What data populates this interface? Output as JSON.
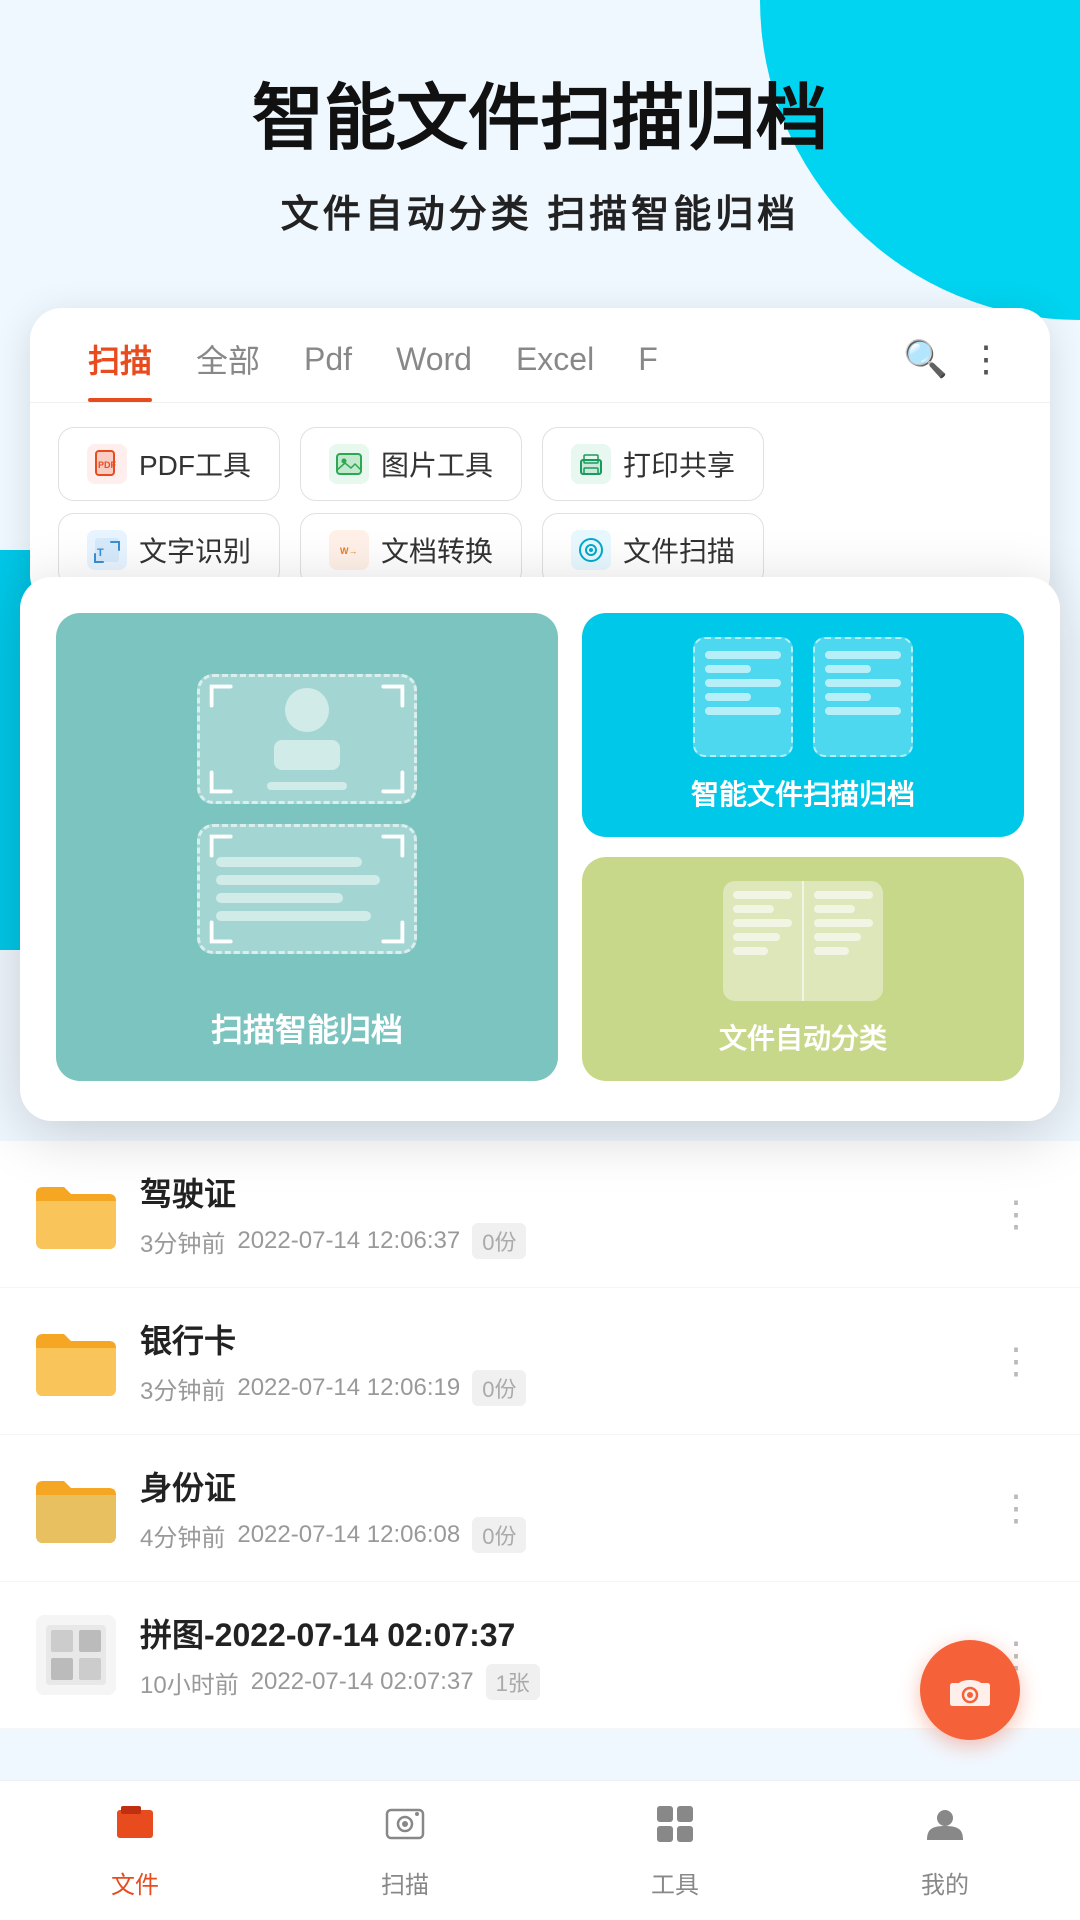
{
  "hero": {
    "title": "智能文件扫描归档",
    "subtitle": "文件自动分类   扫描智能归档"
  },
  "tabs": {
    "items": [
      {
        "label": "扫描",
        "active": true
      },
      {
        "label": "全部",
        "active": false
      },
      {
        "label": "Pdf",
        "active": false
      },
      {
        "label": "Word",
        "active": false
      },
      {
        "label": "Excel",
        "active": false
      },
      {
        "label": "F",
        "active": false
      }
    ]
  },
  "tools": {
    "row1": [
      {
        "label": "PDF工具",
        "icon": "pdf"
      },
      {
        "label": "图片工具",
        "icon": "img"
      },
      {
        "label": "打印共享",
        "icon": "print"
      }
    ],
    "row2": [
      {
        "label": "文字识别",
        "icon": "ocr"
      },
      {
        "label": "文档转换",
        "icon": "convert"
      },
      {
        "label": "文件扫描",
        "icon": "scan"
      }
    ]
  },
  "popup": {
    "left_label": "扫描智能归档",
    "right_top_label": "智能文件扫描归档",
    "right_bottom_label": "文件自动分类"
  },
  "files": [
    {
      "name": "驾驶证",
      "time": "3分钟前",
      "date": "2022-07-14 12:06:37",
      "count": "0份",
      "type": "folder"
    },
    {
      "name": "银行卡",
      "time": "3分钟前",
      "date": "2022-07-14 12:06:19",
      "count": "0份",
      "type": "folder"
    },
    {
      "name": "身份证",
      "time": "4分钟前",
      "date": "2022-07-14 12:06:08",
      "count": "0份",
      "type": "folder"
    },
    {
      "name": "拼图-2022-07-14 02:07:37",
      "time": "10小时前",
      "date": "2022-07-14 02:07:37",
      "count": "1张",
      "type": "image"
    }
  ],
  "bottomNav": {
    "items": [
      {
        "label": "文件",
        "active": true
      },
      {
        "label": "扫描",
        "active": false
      },
      {
        "label": "工具",
        "active": false
      },
      {
        "label": "我的",
        "active": false
      }
    ]
  }
}
